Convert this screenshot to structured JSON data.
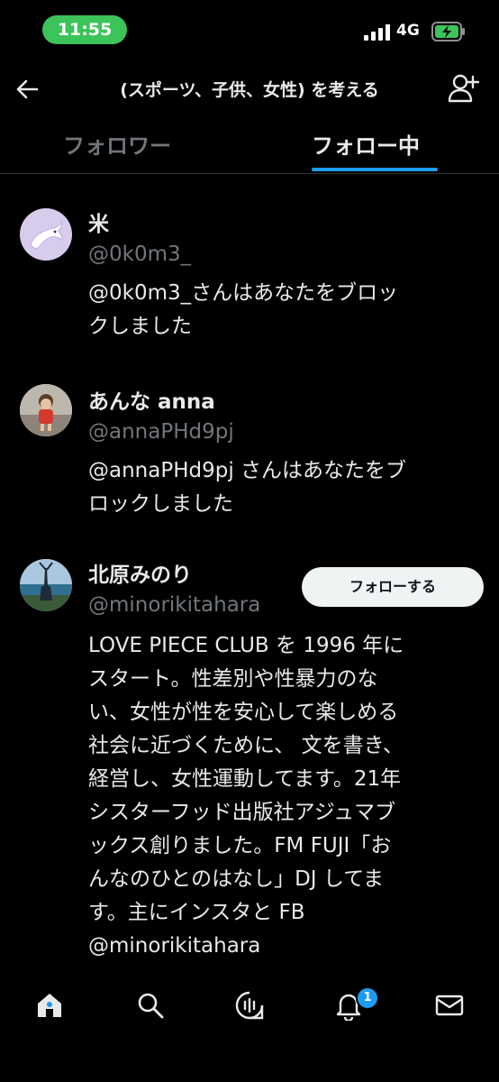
{
  "status_bar": {
    "time": "11:55",
    "network": "4G"
  },
  "header": {
    "title": "(スポーツ、子供、女性) を考える"
  },
  "tabs": [
    {
      "label": "フォロワー",
      "selected": false
    },
    {
      "label": "フォロー中",
      "selected": true
    }
  ],
  "users": [
    {
      "name": "米",
      "handle": "@0k0m3_",
      "bio_lines": [
        "@0k0m3_さんはあなたをブロッ",
        "クしました"
      ]
    },
    {
      "name": "あんな anna",
      "handle": "@annaPHd9pj",
      "bio_lines": [
        "@annaPHd9pj さんはあなたをブ",
        "ロックしました"
      ]
    },
    {
      "name": "北原みのり",
      "handle": "@minorikitahara",
      "follow_button": "フォローする",
      "bio_lines": [
        "LOVE PIECE CLUB を 1996 年に",
        "スタート。性差別や性暴力のな",
        "い、女性が性を安心して楽しめる",
        "社会に近づくために、 文を書き、",
        "経営し、女性運動してます。21年",
        "シスターフッド出版社アジュマブ",
        "ックス創りました。FM FUJI「お",
        "んなのひとのはなし」DJ してま",
        "す。主にインスタと FB",
        "@minorikitahara"
      ]
    }
  ],
  "bottom_nav": {
    "items": [
      "home-icon",
      "search-icon",
      "spaces-icon",
      "notifications-icon",
      "messages-icon"
    ],
    "notification_count": "1"
  },
  "colors": {
    "accent": "#1d9bf0",
    "background": "#000000",
    "status_pill": "#3cc35a"
  }
}
